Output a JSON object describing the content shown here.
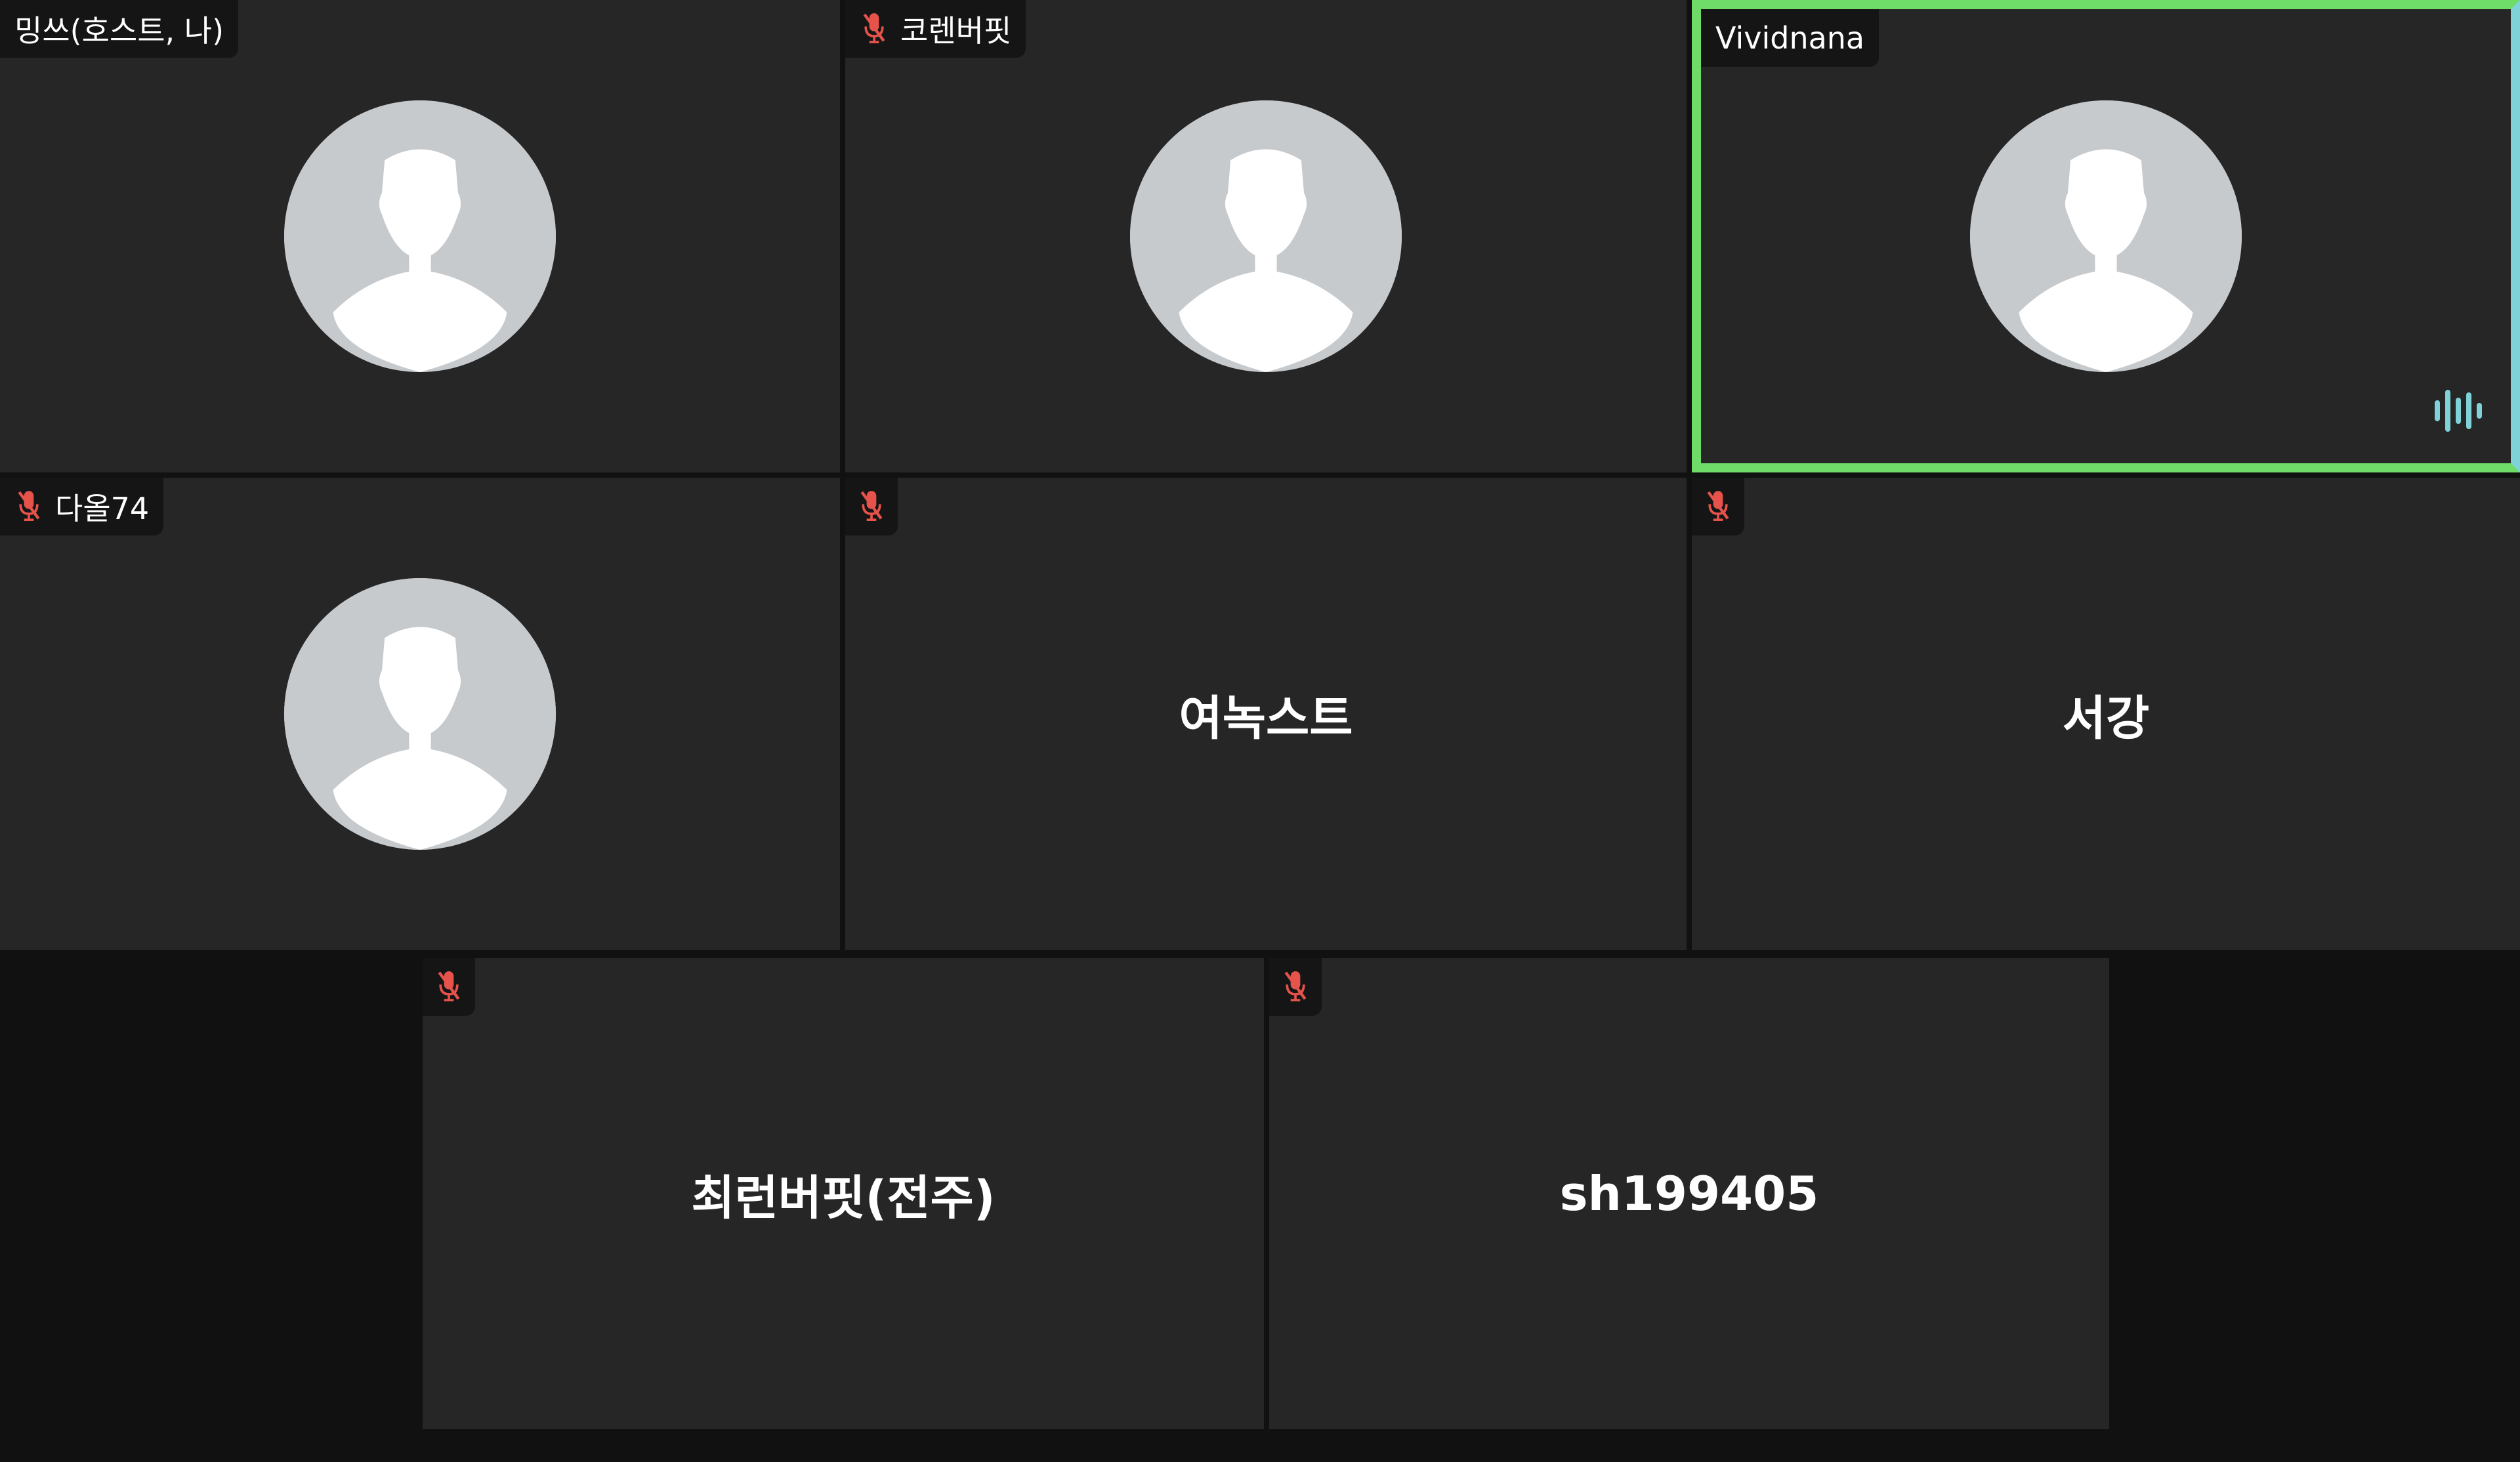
{
  "participants": [
    {
      "name": "밍쓰(호스트, 나)",
      "muted": false,
      "avatar": true
    },
    {
      "name": "코렌버핏",
      "muted": true,
      "avatar": true
    },
    {
      "name": "Vividnana",
      "muted": false,
      "avatar": true,
      "speaking": true
    },
    {
      "name": "다올74",
      "muted": true,
      "avatar": true
    },
    {
      "name": "여녹스트",
      "muted": true,
      "avatar": false
    },
    {
      "name": "서강",
      "muted": true,
      "avatar": false
    },
    {
      "name": "최런버핏(전주)",
      "muted": true,
      "avatar": false
    },
    {
      "name": "sh199405",
      "muted": true,
      "avatar": false
    }
  ],
  "icons": {
    "mic_muted": "mic-muted-icon",
    "avatar": "default-avatar-icon",
    "speaking": "audio-wave-icon"
  },
  "colors": {
    "tile_bg": "#262626",
    "page_bg": "#111111",
    "speaker_border": "#6fdc6a",
    "muted_icon": "#e5534b",
    "avatar_bg": "#c7cacd",
    "wave": "#7fd3d8"
  }
}
